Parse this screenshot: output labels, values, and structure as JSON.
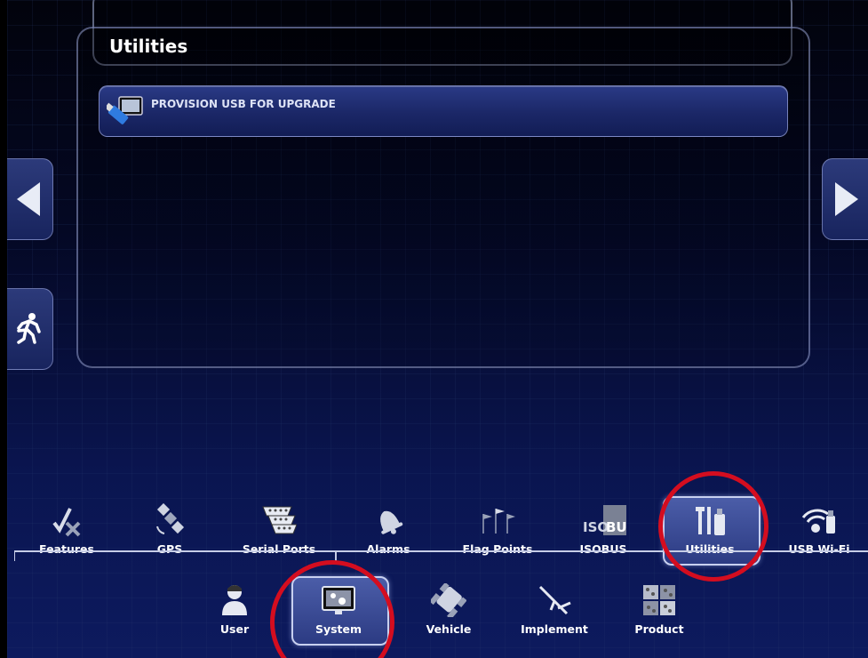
{
  "panel": {
    "title": "Utilities",
    "items": [
      {
        "label": "PROVISION USB FOR UPGRADE",
        "icon": "usb-stick-icon"
      }
    ]
  },
  "nav": {
    "left_arrow_icon": "triangle-left-icon",
    "right_arrow_icon": "triangle-right-icon",
    "exit_icon": "running-man-exit-icon"
  },
  "system_tabs": [
    {
      "label": "Features",
      "icon": "features-check-cross-icon"
    },
    {
      "label": "GPS",
      "icon": "satellite-icon"
    },
    {
      "label": "Serial Ports",
      "icon": "serial-port-icon"
    },
    {
      "label": "Alarms",
      "icon": "bell-icon"
    },
    {
      "label": "Flag Points",
      "icon": "flags-icon"
    },
    {
      "label": "ISOBUS",
      "icon": "isobus-logo-icon",
      "logo_text_a": "ISO",
      "logo_text_b": "BUS"
    },
    {
      "label": "Utilities",
      "icon": "tools-usb-icon",
      "active": true
    },
    {
      "label": "USB Wi-Fi",
      "icon": "wifi-usb-icon"
    }
  ],
  "main_tabs": [
    {
      "label": "User",
      "icon": "user-icon"
    },
    {
      "label": "System",
      "icon": "system-monitor-gear-icon",
      "active": true
    },
    {
      "label": "Vehicle",
      "icon": "tractor-icon"
    },
    {
      "label": "Implement",
      "icon": "implement-icon"
    },
    {
      "label": "Product",
      "icon": "product-seeds-icon"
    }
  ],
  "colors": {
    "highlight_ring": "#d40d1f",
    "active_tab": "#3a4a95",
    "background_bottom": "#0d1a5e"
  }
}
